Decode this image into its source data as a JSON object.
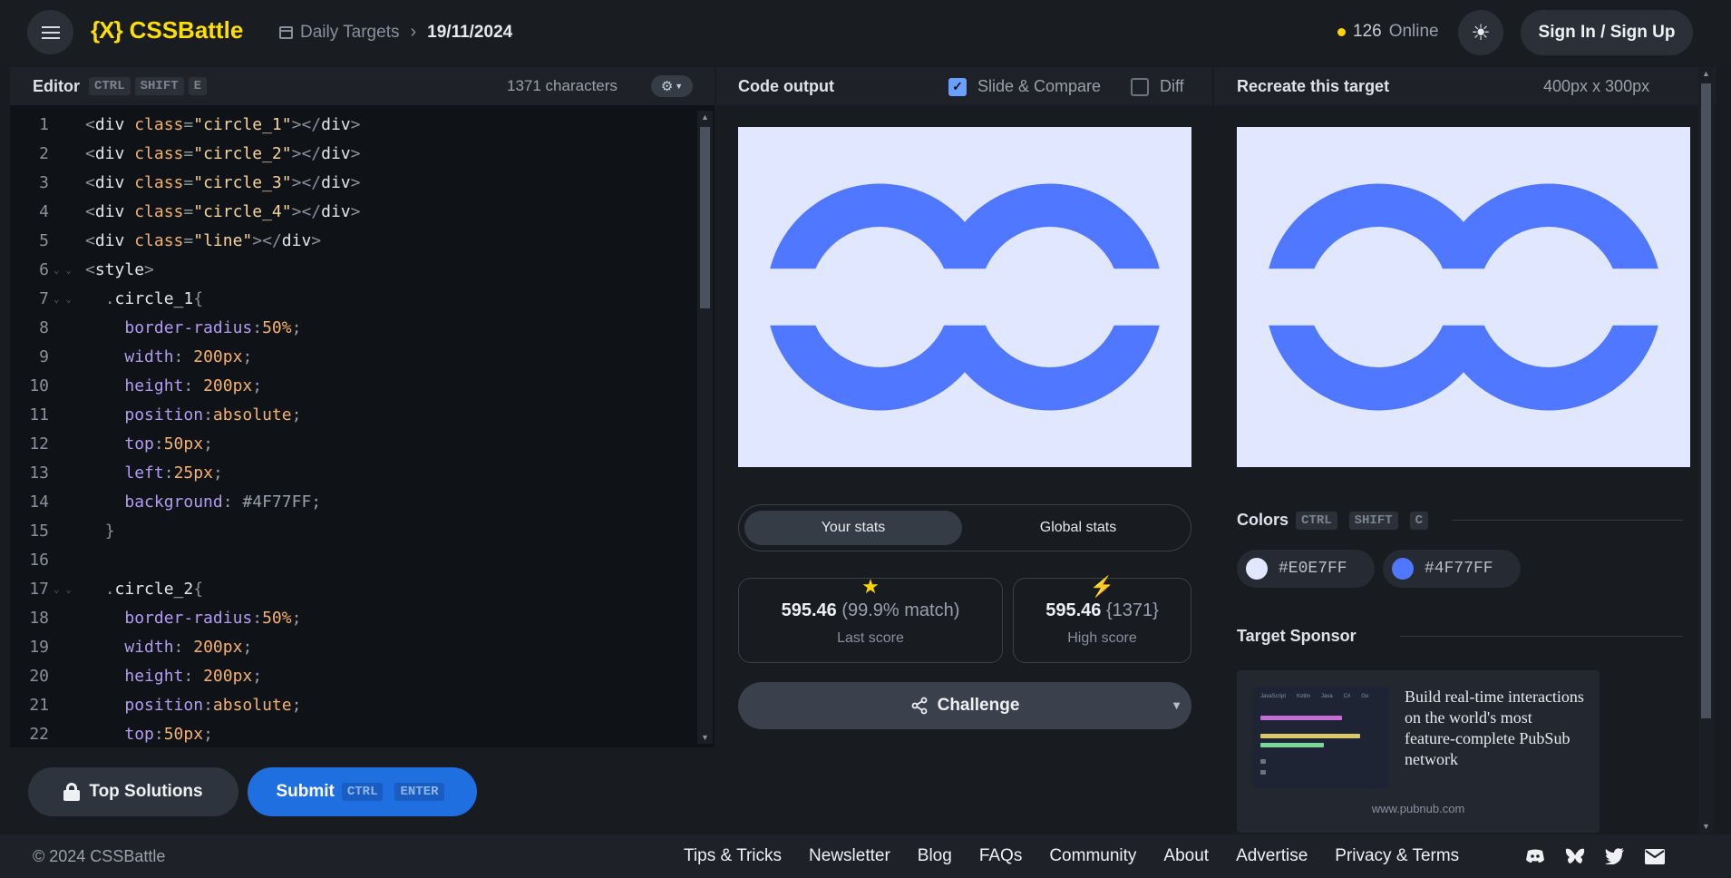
{
  "header": {
    "logo_text": "CSSBattle",
    "logo_mark": "{X}",
    "breadcrumb_link": "Daily Targets",
    "breadcrumb_current": "19/11/2024",
    "online_count": "126",
    "online_label": "Online",
    "signin_label": "Sign In / Sign Up"
  },
  "editor": {
    "title": "Editor",
    "shortcut": [
      "CTRL",
      "SHIFT",
      "E"
    ],
    "char_count": "1371 characters",
    "line_numbers": [
      "1",
      "2",
      "3",
      "4",
      "5",
      "6",
      "7",
      "8",
      "9",
      "10",
      "11",
      "12",
      "13",
      "14",
      "15",
      "16",
      "17",
      "18",
      "19",
      "20",
      "21",
      "22"
    ],
    "top_solutions_label": "Top Solutions",
    "submit_label": "Submit",
    "submit_shortcut": [
      "CTRL",
      "ENTER"
    ]
  },
  "code_lines": [
    [
      "<",
      "div",
      " ",
      "class",
      "=",
      "\"circle_1\"",
      "></",
      "div",
      ">"
    ],
    [
      "<",
      "div",
      " ",
      "class",
      "=",
      "\"circle_2\"",
      "></",
      "div",
      ">"
    ],
    [
      "<",
      "div",
      " ",
      "class",
      "=",
      "\"circle_3\"",
      "></",
      "div",
      ">"
    ],
    [
      "<",
      "div",
      " ",
      "class",
      "=",
      "\"circle_4\"",
      "></",
      "div",
      ">"
    ],
    [
      "<",
      "div",
      " ",
      "class",
      "=",
      "\"line\"",
      "></",
      "div",
      ">"
    ]
  ],
  "css": {
    "style_open": "style",
    "selector_1": "circle_1",
    "selector_2": "circle_2",
    "br_prop": "border-radius",
    "br_val": "50%",
    "w_prop": "width",
    "w_val": "200",
    "px": "px",
    "h_prop": "height",
    "h_val": "200",
    "pos_prop": "position",
    "pos_val": "absolute",
    "top_prop": "top",
    "top_val": "50",
    "left_prop": "left",
    "left_val": "25",
    "bg_prop": "background",
    "bg_val": "#4F77FF"
  },
  "output": {
    "title": "Code output",
    "slide_compare_label": "Slide & Compare",
    "slide_compare_checked": true,
    "diff_label": "Diff",
    "diff_checked": false,
    "tab_your": "Your stats",
    "tab_global": "Global stats",
    "last_score": "595.46",
    "last_match": "(99.9% match)",
    "last_label": "Last score",
    "high_score": "595.46",
    "high_chars": "{1371}",
    "high_label": "High score",
    "challenge_label": "Challenge"
  },
  "target": {
    "title": "Recreate this target",
    "dimensions": "400px x 300px",
    "colors_title": "Colors",
    "colors_shortcut": [
      "CTRL",
      "SHIFT",
      "C"
    ],
    "colors": [
      "#E0E7FF",
      "#4F77FF"
    ],
    "sponsor_title": "Target Sponsor",
    "sponsor_text": "Build real-time interactions on the world's most feature-complete PubSub network",
    "sponsor_url": "www.pubnub.com",
    "sponsor_tabs": [
      "JavaScript",
      "Kotlin",
      "Java",
      "C#",
      "Go"
    ]
  },
  "footer": {
    "copyright": "© 2024 CSSBattle",
    "links": [
      "Tips & Tricks",
      "Newsletter",
      "Blog",
      "FAQs",
      "Community",
      "About",
      "Advertise",
      "Privacy & Terms"
    ],
    "icons": [
      "discord-icon",
      "bluesky-icon",
      "twitter-icon",
      "email-icon"
    ]
  },
  "colors": {
    "accent_yellow": "#FFDF00",
    "submit_blue": "#1F6FE0",
    "canvas_bg": "#E0E7FF",
    "shape_blue": "#4F77FF"
  }
}
